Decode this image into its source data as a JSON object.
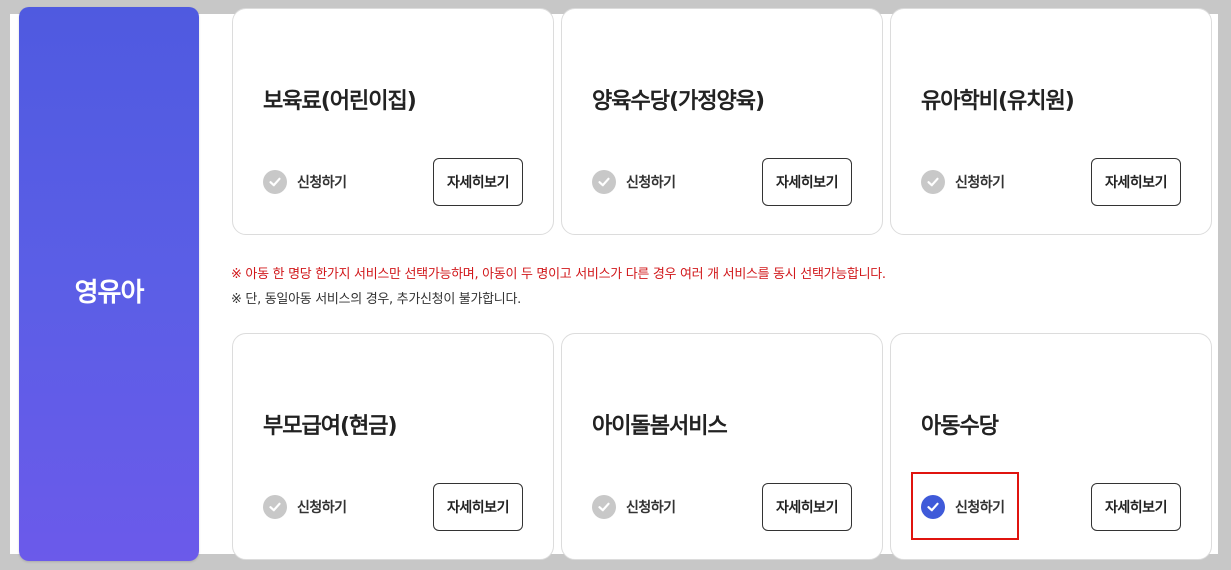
{
  "category": {
    "title": "영유아"
  },
  "cards_top": [
    {
      "title": "보육료(어린이집)",
      "apply_label": "신청하기",
      "detail_label": "자세히보기",
      "checked": false
    },
    {
      "title": "양육수당(가정양육)",
      "apply_label": "신청하기",
      "detail_label": "자세히보기",
      "checked": false
    },
    {
      "title": "유아학비(유치원)",
      "apply_label": "신청하기",
      "detail_label": "자세히보기",
      "checked": false
    }
  ],
  "notes": {
    "line1": "※ 아동 한 명당 한가지 서비스만 선택가능하며, 아동이 두 명이고 서비스가 다른 경우 여러 개 서비스를 동시 선택가능합니다.",
    "line2": "※ 단, 동일아동 서비스의 경우, 추가신청이 불가합니다."
  },
  "cards_bottom": [
    {
      "title": "부모급여(현금)",
      "apply_label": "신청하기",
      "detail_label": "자세히보기",
      "checked": false
    },
    {
      "title": "아이돌봄서비스",
      "apply_label": "신청하기",
      "detail_label": "자세히보기",
      "checked": false
    },
    {
      "title": "아동수당",
      "apply_label": "신청하기",
      "detail_label": "자세히보기",
      "checked": true
    }
  ],
  "colors": {
    "accent": "#3f5ad9",
    "note_red": "#d1181b",
    "unchecked": "#c8c8c8",
    "highlight_box": "#e0140f"
  }
}
